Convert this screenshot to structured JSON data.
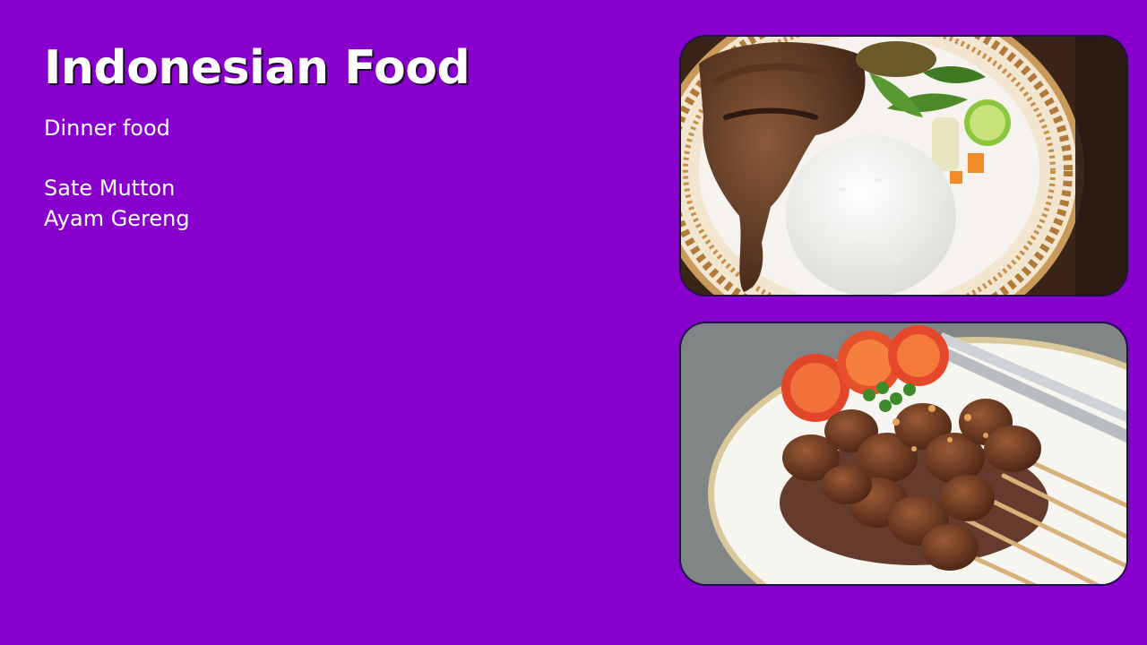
{
  "slide": {
    "background": "#8800cc",
    "title": "Indonesian Food",
    "subtitle": "Dinner food",
    "items": [
      "Sate Mutton",
      "Ayam Gereng"
    ]
  },
  "images": [
    {
      "semantic": "fried-chicken-rice-plate-photo"
    },
    {
      "semantic": "satay-skewers-plate-photo"
    }
  ]
}
